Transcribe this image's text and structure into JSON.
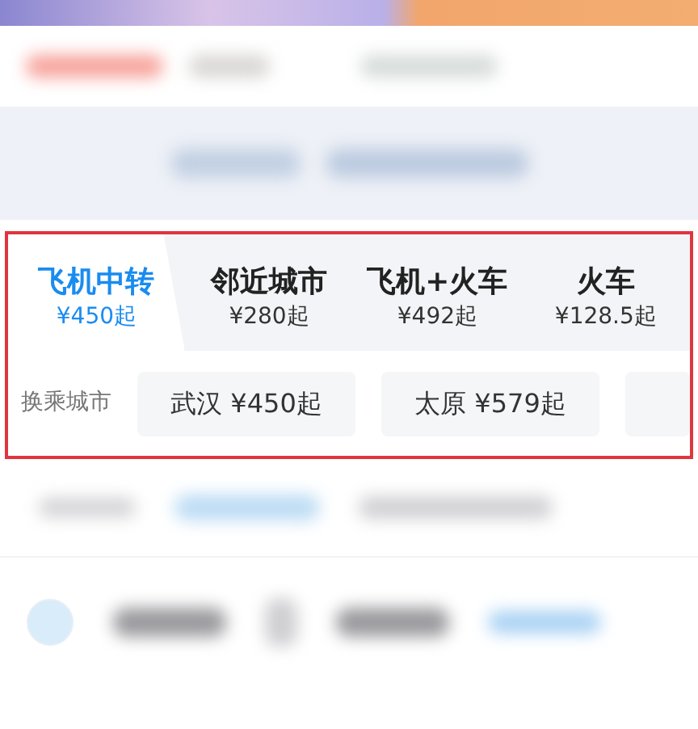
{
  "tabs": [
    {
      "title": "飞机中转",
      "price": "¥450起",
      "selected": true
    },
    {
      "title": "邻近城市",
      "price": "¥280起",
      "selected": false
    },
    {
      "title": "飞机+火车",
      "price": "¥492起",
      "selected": false
    },
    {
      "title": "火车",
      "price": "¥128.5起",
      "selected": false
    }
  ],
  "transfer": {
    "label": "换乘城市",
    "cities": [
      {
        "text": "武汉 ¥450起"
      },
      {
        "text": "太原 ¥579起"
      }
    ]
  }
}
